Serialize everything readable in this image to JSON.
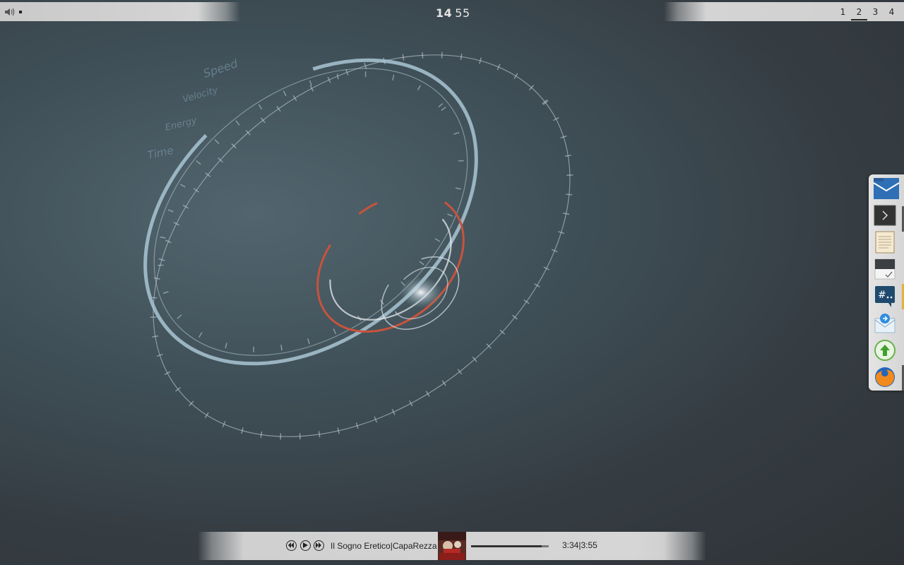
{
  "top_panel": {
    "clock_hours": "14",
    "clock_minutes": "55",
    "workspaces": [
      "1",
      "2",
      "3",
      "4"
    ],
    "active_workspace": "2",
    "volume_icon": "speaker-icon"
  },
  "wallpaper": {
    "hud_labels": [
      "Speed",
      "Velocity",
      "Energy",
      "Time"
    ]
  },
  "dock": {
    "items": [
      {
        "name": "mail-folder-icon"
      },
      {
        "name": "terminal-icon"
      },
      {
        "name": "text-editor-icon"
      },
      {
        "name": "tasks-icon"
      },
      {
        "name": "irc-chat-icon"
      },
      {
        "name": "mail-send-icon"
      },
      {
        "name": "update-manager-icon"
      },
      {
        "name": "firefox-icon"
      }
    ]
  },
  "player": {
    "track_title": "Il Sogno Eretico",
    "separator": "|",
    "artist": "CapaRezza",
    "elapsed": "3:34",
    "total": "3:55",
    "progress": 0.91,
    "controls": [
      "previous-icon",
      "play-icon",
      "next-icon"
    ]
  },
  "colors": {
    "accent_red": "#c8533d",
    "ring_light": "#a9c6d4",
    "panel_gray": "#d4d4d4"
  }
}
